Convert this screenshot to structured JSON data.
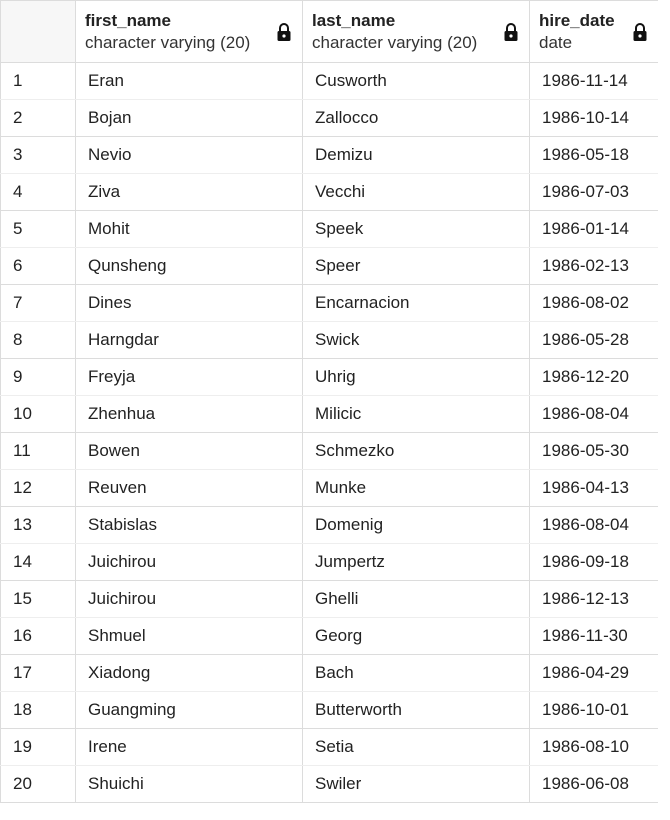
{
  "columns": [
    {
      "name": "first_name",
      "type": "character varying (20)"
    },
    {
      "name": "last_name",
      "type": "character varying (20)"
    },
    {
      "name": "hire_date",
      "type": "date"
    }
  ],
  "rows": [
    {
      "n": "1",
      "first_name": "Eran",
      "last_name": "Cusworth",
      "hire_date": "1986-11-14"
    },
    {
      "n": "2",
      "first_name": "Bojan",
      "last_name": "Zallocco",
      "hire_date": "1986-10-14"
    },
    {
      "n": "3",
      "first_name": "Nevio",
      "last_name": "Demizu",
      "hire_date": "1986-05-18"
    },
    {
      "n": "4",
      "first_name": "Ziva",
      "last_name": "Vecchi",
      "hire_date": "1986-07-03"
    },
    {
      "n": "5",
      "first_name": "Mohit",
      "last_name": "Speek",
      "hire_date": "1986-01-14"
    },
    {
      "n": "6",
      "first_name": "Qunsheng",
      "last_name": "Speer",
      "hire_date": "1986-02-13"
    },
    {
      "n": "7",
      "first_name": "Dines",
      "last_name": "Encarnacion",
      "hire_date": "1986-08-02"
    },
    {
      "n": "8",
      "first_name": "Harngdar",
      "last_name": "Swick",
      "hire_date": "1986-05-28"
    },
    {
      "n": "9",
      "first_name": "Freyja",
      "last_name": "Uhrig",
      "hire_date": "1986-12-20"
    },
    {
      "n": "10",
      "first_name": "Zhenhua",
      "last_name": "Milicic",
      "hire_date": "1986-08-04"
    },
    {
      "n": "11",
      "first_name": "Bowen",
      "last_name": "Schmezko",
      "hire_date": "1986-05-30"
    },
    {
      "n": "12",
      "first_name": "Reuven",
      "last_name": "Munke",
      "hire_date": "1986-04-13"
    },
    {
      "n": "13",
      "first_name": "Stabislas",
      "last_name": "Domenig",
      "hire_date": "1986-08-04"
    },
    {
      "n": "14",
      "first_name": "Juichirou",
      "last_name": "Jumpertz",
      "hire_date": "1986-09-18"
    },
    {
      "n": "15",
      "first_name": "Juichirou",
      "last_name": "Ghelli",
      "hire_date": "1986-12-13"
    },
    {
      "n": "16",
      "first_name": "Shmuel",
      "last_name": "Georg",
      "hire_date": "1986-11-30"
    },
    {
      "n": "17",
      "first_name": "Xiadong",
      "last_name": "Bach",
      "hire_date": "1986-04-29"
    },
    {
      "n": "18",
      "first_name": "Guangming",
      "last_name": "Butterworth",
      "hire_date": "1986-10-01"
    },
    {
      "n": "19",
      "first_name": "Irene",
      "last_name": "Setia",
      "hire_date": "1986-08-10"
    },
    {
      "n": "20",
      "first_name": "Shuichi",
      "last_name": "Swiler",
      "hire_date": "1986-06-08"
    }
  ],
  "icons": {
    "column_lock": "lock-icon"
  },
  "colors": {
    "border": "#dcdcdc",
    "corner_bg": "#f7f7f7"
  }
}
